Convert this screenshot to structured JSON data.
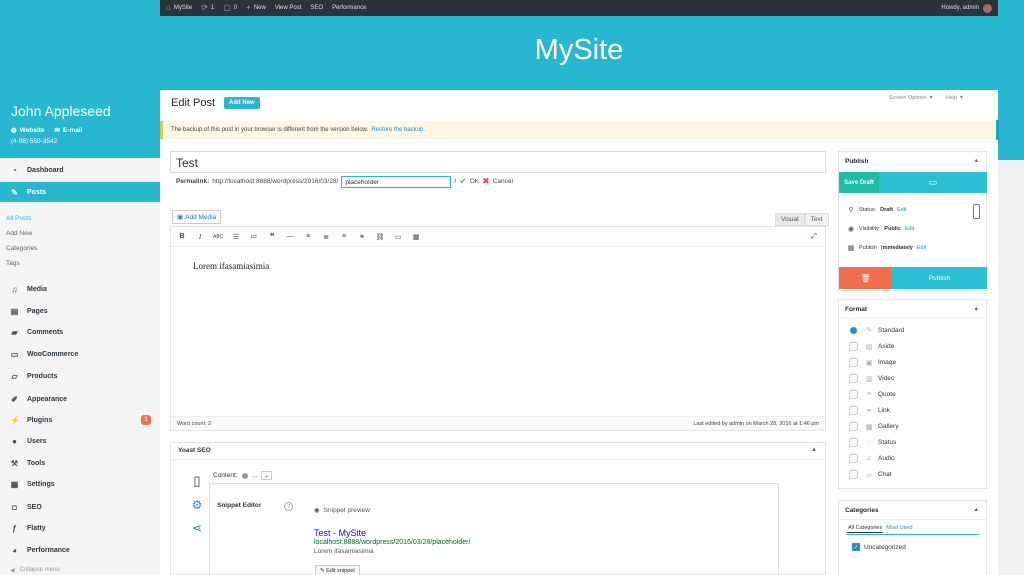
{
  "admin_bar": {
    "site": "MySite",
    "updates": "1",
    "comments": "0",
    "new": "New",
    "view_post": "View Post",
    "seo": "SEO",
    "performance": "Performance",
    "howdy": "Howdy, admin"
  },
  "site_title": "MySite",
  "profile": {
    "name": "John Appleseed",
    "website": "Website",
    "email": "E-mail",
    "phone": "(4 08) 550-3542"
  },
  "menu": {
    "dashboard": "Dashboard",
    "posts": "Posts",
    "sub_all_posts": "All Posts",
    "sub_add_new": "Add New",
    "sub_categories": "Categories",
    "sub_tags": "Tags",
    "media": "Media",
    "pages": "Pages",
    "comments": "Comments",
    "woocommerce": "WooCommerce",
    "products": "Products",
    "appearance": "Appearance",
    "plugins": "Plugins",
    "plugins_badge": "1",
    "users": "Users",
    "tools": "Tools",
    "settings": "Settings",
    "seo": "SEO",
    "flatty": "Flatty",
    "performance": "Performance",
    "collapse": "Collapse menu"
  },
  "page": {
    "heading": "Edit Post",
    "add_new": "Add New",
    "screen_options": "Screen Options ▼",
    "help": "Help ▼"
  },
  "notice": {
    "text": "The backup of this post in your browser is different from the version below.",
    "link": "Restore the backup."
  },
  "post": {
    "title": "Test",
    "permalink_label": "Permalink:",
    "permalink_base": "http://localhost:8888/wordpress/2016/03/28/",
    "slug": "placeholder",
    "slug_trailing": "/",
    "ok": "OK",
    "cancel": "Cancel",
    "add_media": "Add Media",
    "tab_visual": "Visual",
    "tab_text": "Text",
    "body": "Lorem ifasamiasimia",
    "word_count": "Word count: 2",
    "last_edited": "Last edited by admin on March 28, 2016 at 1:46 pm"
  },
  "yoast": {
    "title": "Yoast SEO",
    "content_label": "Content:",
    "content_more": "...",
    "snippet_editor": "Snippet Editor",
    "help": "?",
    "snippet_preview": "Snippet preview",
    "snippet_title": "Test - MySite",
    "snippet_url": "localhost:8888/wordpress/2016/03/28/placeholder/",
    "snippet_desc": "Lorem ifasamiasimia",
    "edit_snippet": "Edit snippet"
  },
  "publish_box": {
    "title": "Publish",
    "save_draft": "Save Draft",
    "status_label": "Status:",
    "status_value": "Draft",
    "visibility_label": "Visibility:",
    "visibility_value": "Public",
    "publish_label": "Publish",
    "publish_value": "immediately",
    "edit": "Edit",
    "publish_button": "Publish"
  },
  "format_box": {
    "title": "Format",
    "options": [
      "Standard",
      "Aside",
      "Image",
      "Video",
      "Quote",
      "Link",
      "Gallery",
      "Status",
      "Audio",
      "Chat"
    ]
  },
  "categories_box": {
    "title": "Categories",
    "tab_all": "All Categories",
    "tab_used": "Most Used",
    "item": "Uncategorized"
  },
  "colors": {
    "accent": "#27b8cf",
    "green": "#1fbca3",
    "orange": "#f36e4d"
  }
}
